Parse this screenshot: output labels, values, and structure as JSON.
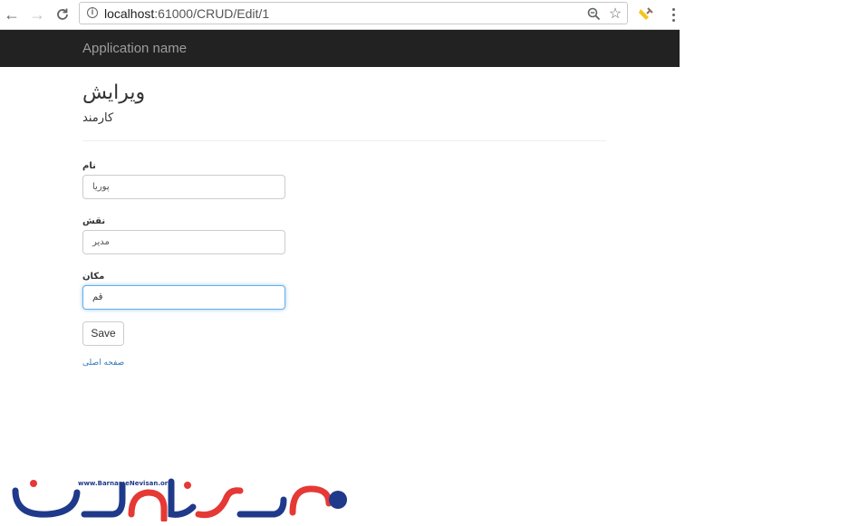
{
  "browser": {
    "url_host": "localhost",
    "url_path": ":61000/CRUD/Edit/1"
  },
  "navbar": {
    "brand": "Application name"
  },
  "page": {
    "title": "ویرایش",
    "subtitle": "کارمند"
  },
  "form": {
    "fields": [
      {
        "label": "نام",
        "value": "پوریا"
      },
      {
        "label": "نقش",
        "value": "مدیر"
      },
      {
        "label": "مکان",
        "value": "قم"
      }
    ],
    "save_label": "Save",
    "back_link": "صفحه اصلی"
  },
  "watermark": {
    "url_text": "www.BarnameNevisan.org",
    "colors": {
      "blue": "#1f3a8a",
      "red": "#e53935"
    }
  }
}
